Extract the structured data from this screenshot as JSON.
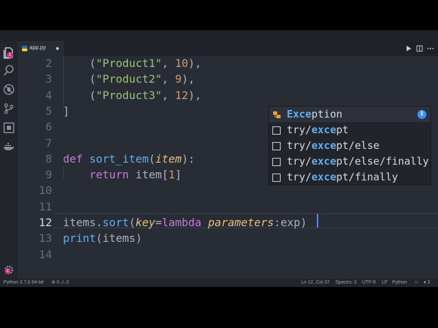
{
  "tab": {
    "filename": "app.py",
    "unsaved": true
  },
  "activity_bar": {
    "items": [
      "files-icon",
      "search-icon",
      "no-bug-icon",
      "source-control-icon",
      "extensions-icon",
      "docker-icon"
    ],
    "explorer_badge": "1",
    "settings_badge": "1"
  },
  "editor": {
    "lines": [
      {
        "n": "2",
        "tokens": [
          {
            "t": "    (",
            "c": "pl"
          },
          {
            "t": "\"Product1\"",
            "c": "str"
          },
          {
            "t": ", ",
            "c": "pl"
          },
          {
            "t": "10",
            "c": "num"
          },
          {
            "t": "),",
            "c": "pl"
          }
        ]
      },
      {
        "n": "3",
        "tokens": [
          {
            "t": "    (",
            "c": "pl"
          },
          {
            "t": "\"Product2\"",
            "c": "str"
          },
          {
            "t": ", ",
            "c": "pl"
          },
          {
            "t": "9",
            "c": "num"
          },
          {
            "t": "),",
            "c": "pl"
          }
        ]
      },
      {
        "n": "4",
        "tokens": [
          {
            "t": "    (",
            "c": "pl"
          },
          {
            "t": "\"Product3\"",
            "c": "str"
          },
          {
            "t": ", ",
            "c": "pl"
          },
          {
            "t": "12",
            "c": "num"
          },
          {
            "t": "),",
            "c": "pl"
          }
        ]
      },
      {
        "n": "5",
        "tokens": [
          {
            "t": "]",
            "c": "pl"
          }
        ]
      },
      {
        "n": "6",
        "tokens": []
      },
      {
        "n": "7",
        "tokens": []
      },
      {
        "n": "8",
        "tokens": [
          {
            "t": "def ",
            "c": "kw"
          },
          {
            "t": "sort_item",
            "c": "fn"
          },
          {
            "t": "(",
            "c": "pl"
          },
          {
            "t": "item",
            "c": "param"
          },
          {
            "t": "):",
            "c": "pl"
          }
        ]
      },
      {
        "n": "9",
        "tokens": [
          {
            "t": "    ",
            "c": "pl"
          },
          {
            "t": "return",
            "c": "kw"
          },
          {
            "t": " item[",
            "c": "pl"
          },
          {
            "t": "1",
            "c": "num"
          },
          {
            "t": "]",
            "c": "pl"
          }
        ]
      },
      {
        "n": "10",
        "tokens": []
      },
      {
        "n": "11",
        "tokens": []
      },
      {
        "n": "12",
        "tokens": [
          {
            "t": "items.",
            "c": "pl"
          },
          {
            "t": "sort",
            "c": "fn"
          },
          {
            "t": "(",
            "c": "pl"
          },
          {
            "t": "key",
            "c": "param"
          },
          {
            "t": "=",
            "c": "pl"
          },
          {
            "t": "lambda ",
            "c": "kw"
          },
          {
            "t": "parameters",
            "c": "param"
          },
          {
            "t": ":exp)",
            "c": "pl"
          }
        ]
      },
      {
        "n": "13",
        "tokens": [
          {
            "t": "print",
            "c": "fn"
          },
          {
            "t": "(items)",
            "c": "pl"
          }
        ]
      },
      {
        "n": "14",
        "tokens": []
      }
    ],
    "active_line": "12"
  },
  "suggestions": [
    {
      "pre": "",
      "match": "Exc",
      "mid": "",
      "match2": "e",
      "post": "ption",
      "icon": "class-icon",
      "selected": true
    },
    {
      "pre": "try/",
      "match": "exc",
      "mid": "",
      "match2": "e",
      "post": "pt",
      "icon": "snippet-icon"
    },
    {
      "pre": "try/",
      "match": "exc",
      "mid": "",
      "match2": "e",
      "post": "pt/else",
      "icon": "snippet-icon"
    },
    {
      "pre": "try/",
      "match": "exc",
      "mid": "",
      "match2": "e",
      "post": "pt/else/finally",
      "icon": "snippet-icon"
    },
    {
      "pre": "try/",
      "match": "exc",
      "mid": "",
      "match2": "e",
      "post": "pt/finally",
      "icon": "snippet-icon"
    }
  ],
  "status": {
    "interpreter": "Python 3.7.0 64-bit",
    "errors": "0",
    "warnings": "0",
    "position": "Ln 12, Col 37",
    "spaces": "Spaces: 2",
    "encoding": "UTF-8",
    "eol": "LF",
    "language": "Python",
    "notifications": "3"
  },
  "colors": {
    "background": "#282c34",
    "keyword": "#c678dd",
    "function": "#61afef",
    "string": "#98c379",
    "number": "#d19a66",
    "parameter": "#e5c07b",
    "badge": "#d62f88"
  }
}
